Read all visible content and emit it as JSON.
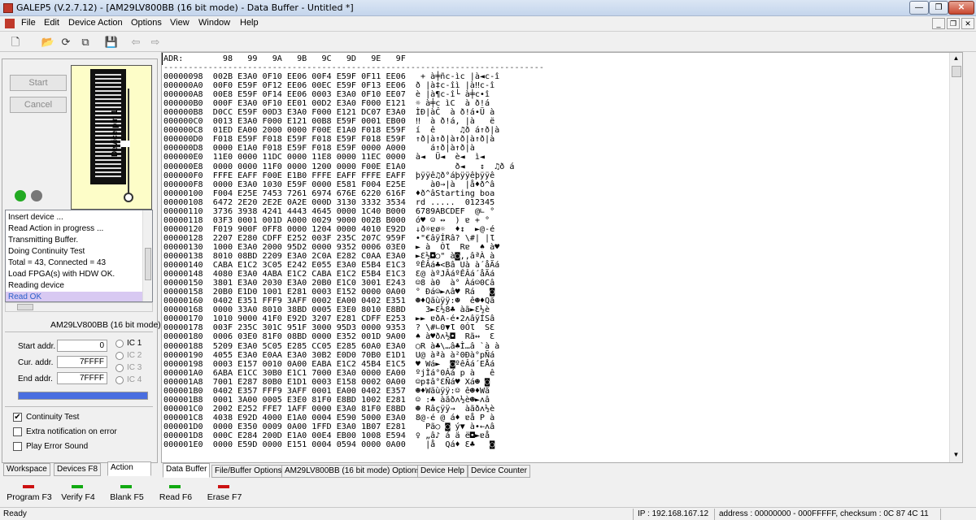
{
  "window": {
    "title": "GALEP5 (V.2.7.12) - [AM29LV800BB (16 bit mode) - Data Buffer - Untitled *]"
  },
  "menu": [
    "File",
    "Edit",
    "Device Action",
    "Options",
    "View",
    "Window",
    "Help"
  ],
  "left": {
    "start_label": "Start",
    "cancel_label": "Cancel",
    "device_pin_label": "Device pin 1",
    "indicator_colors": [
      "#22aa22",
      "#777777"
    ],
    "log": [
      "Insert device ...",
      "Read Action in progress ...",
      "Transmitting Buffer.",
      "Doing Continuity Test",
      "Total = 43, Connected = 43",
      "Load FPGA(s) with HDW OK.",
      "Reading device",
      "Read OK"
    ],
    "device_name": "AM29LV800BB (16 bit mode)",
    "start_addr_label": "Start addr.",
    "start_addr_value": "0",
    "cur_addr_label": "Cur. addr.",
    "cur_addr_value": "7FFFF",
    "end_addr_label": "End addr.",
    "end_addr_value": "7FFFF",
    "ic_options": [
      "IC 1",
      "IC 2",
      "IC 3",
      "IC 4"
    ],
    "progress": 1.0,
    "progress_color": "#4a6ee0",
    "checks": [
      {
        "label": "Continuity Test",
        "checked": "✔"
      },
      {
        "label": "Extra notification on error",
        "checked": ""
      },
      {
        "label": "Play Error Sound",
        "checked": ""
      }
    ],
    "tabs": [
      "Workspace",
      "Devices  F8",
      "Action"
    ]
  },
  "buffer": {
    "header": "ADR:        98   99   9A   9B   9C   9D   9E   9F",
    "divider": "-----------------------------------------------------------------------------",
    "rows": [
      "00000098  002B E3A0 0F10 EE06 00F4 E59F 0F11 EE06   + à╪ñc-ìc ∣à◄c-î",
      "000000A0  00F0 E59F 0F12 EE06 00EC E59F 0F13 EE06  ð ∣à‡c-îì ∣à‼c-î",
      "000000A8  00E8 E59F 0F14 EE06 0003 E3A0 0F10 EE07  è ∣à¶c-î└ à╪c•î",
      "000000B0  000F E3A0 0F10 EE01 00D2 E3A0 F000 E121  ☼ à╪c ìC  à ð!á",
      "000000B8  D0CC E59F 00D3 E3A0 F000 E121 DC07 E3A0  ÌÐ∣àČ  à ð!á•Ü à",
      "000000C0  0013 E3A0 F000 E121 00B8 E59F 0001 EB00  ‼  à ð!á, ∣à   ë",
      "000000C8  01ED EA00 2000 0000 F00E E1A0 F018 E59F  í  ê     ♫ð á↑ð∣à",
      "000000D0  F018 E59F F018 E59F F018 E59F F018 E59F  ↑ð∣à↑ð∣à↑ð∣à↑ð∣à",
      "000000D8  0000 E1A0 F018 E59F F018 E59F 0000 A000     á↑ð∣à↑ð∣à",
      "000000E0  11E0 0000 11DC 0000 11E8 0000 11EC 0000  à◄  Ü◄  è◄  ì◄",
      "000000E8  0000 0000 11F0 0000 1200 0000 F00E E1A0          ð◄   ↕  ♫ð á",
      "000000F0  FFFE EAFF F00E E1B0 FFFE EAFF FFFE EAFF  þÿÿê♫ð°áþÿÿêþÿÿê",
      "000000F8  0000 E3A0 1030 E59F 0000 E581 F004 E25E     à0→∣à  ∣å♦ð^â",
      "00000100  F004 E25E 7453 7261 6974 676E 6220 616F  ♦ð^âStarting boa",
      "00000108  6472 2E20 2E2E 0A2E 000D 3130 3332 3534  rd .....  012345",
      "00000110  3736 3938 4241 4443 4645 0000 1C40 B000  6789ABCDEF  @∟ °",
      "00000118  03F3 0001 001D A000 0029 9000 002B B000  ó♥ ☺ ↔  ) ɐ + °",
      "00000120  F019 900F 0FF8 0000 1204 0000 4010 E92D  ↓ð☼ɐø☼  ♦↕  ►@-é",
      "00000128  2207 E280 CDFF E252 003F 235C 207C 959F  •\"€âÿÍRâ? \\#| ∣Ɩ",
      "00000130  1000 E3A0 2000 95D2 0000 9352 0006 03E0  ► à  ÒƖ  Rɐ  ♠ à♥",
      "00000138  8010 08BD 2209 E3A0 2C0A E282 C0AA E3A0  ►Ɛ½◘○\" à◙,‚âªÀ à",
      "00000140  CABA E1C2 3C05 E242 E055 E3A0 E5B4 E1C3  ºÊÂá♣<Bâ Uà à´åÃá",
      "00000148  4080 E3A0 4ABA E1C2 CABA E1C2 E5B4 E1C3  Ɛ@ àºJÂáºÊÂá´åÃá",
      "00000150  3801 E3A0 2030 E3A0 20B0 E1C0 3001 E243  ☺8 à0  à° Àá☺0Câ",
      "00000158  20B0 E1D0 1001 E281 0003 E152 0000 0A00  ° Ðá☺►ʌâ♥ Rá   ◙",
      "00000160  0402 E351 FFF9 3AFF 0002 EA00 0402 E351  ☻♦Qãùÿÿ:☻  ê☻♦Qã",
      "00000168  0000 33A0 8010 38BD 0005 E3E0 8010 E8BD    3►Ɛ½8♣ àã►Ɛ½è",
      "00000170  1010 9000 41F0 E92D 3207 E281 CDFF E253  ►► ɐðA-é•2ʌâÿÍSâ",
      "00000178  003F 235C 301C 951F 3000 95D3 0000 9353  ? \\#∟0▼Ɩ 0ÓƖ  SƐ",
      "00000180  0006 03E0 81F0 08BD 0000 E352 001D 9A00  ♠ à♥ðʌ½◘  Rã↔  Ɛ",
      "00000188  5209 E3A0 5C05 E285 CC05 E285 60A0 E3A0  ○R à♣\\…â♣Ì…â `à à",
      "00000190  4055 E3A0 E0AA E3A0 30B2 E0D0 70B0 E1D1  U@ àªà à²0Ðà°pÑá",
      "00000198  0003 E157 0010 0A00 EABA E1C2 45B4 E1C5  ♥ Wá►  ◙ºêÂá´EÅá",
      "000001A0  6ABA E1CC 30B0 E1C1 7000 E3A0 0000 EA00  ºjÌá°0Áá p à   ê",
      "000001A8  7001 E287 80B0 E1D1 0003 E158 0002 0A00  ☺p‡â°ƐÑá♥ Xá☻ ◙",
      "000001B0  0402 E357 FFF9 3AFF 0001 EA00 0402 E357  ☻♦Wãùÿÿ:☺ ê☻♦Wã",
      "000001B8  0001 3A00 0005 E3E0 81F0 E8BD 1002 E281  ☺ :♣ àãðʌ½è☻►ʌâ",
      "000001C0  2002 E252 FFE7 1AFF 0000 E3A0 81F0 E8BD  ☻ Râçÿÿ→  àãðʌ½è",
      "000001C8  4038 E92D 4000 E1A0 0004 E590 5000 E3A0  8@-é @ á♦ ɐå P à",
      "000001D0  0000 E350 0009 0A00 1FFD E3A0 1B07 E281    Pã○ ◙ ý▼ à•←ʌâ",
      "000001D8  000C E284 200D E1A0 00E4 EB00 1008 E594  ♀ „â♪ á ä ë◘►ɐå",
      "000001E0  0000 E59D 0000 E151 0004 0594 0000 0A00    ∣å  Qá♦ Ɛ♣   ◙"
    ]
  },
  "doc_tabs": [
    "Data Buffer",
    "File/Buffer Options",
    "AM29LV800BB (16 bit mode) Options",
    "Device Help",
    "Device Counter"
  ],
  "actions": [
    {
      "label": "Program  F3",
      "color": "#cc1111"
    },
    {
      "label": "Verify  F4",
      "color": "#11aa11"
    },
    {
      "label": "Blank  F5",
      "color": "#11aa11"
    },
    {
      "label": "Read  F6",
      "color": "#11aa11"
    },
    {
      "label": "Erase  F7",
      "color": "#cc1111"
    }
  ],
  "status": {
    "ready": "Ready",
    "ip": "IP : 192.168.167.12",
    "address": "address : 00000000 - 000FFFFF, checksum : 0C 87 4C 11"
  }
}
